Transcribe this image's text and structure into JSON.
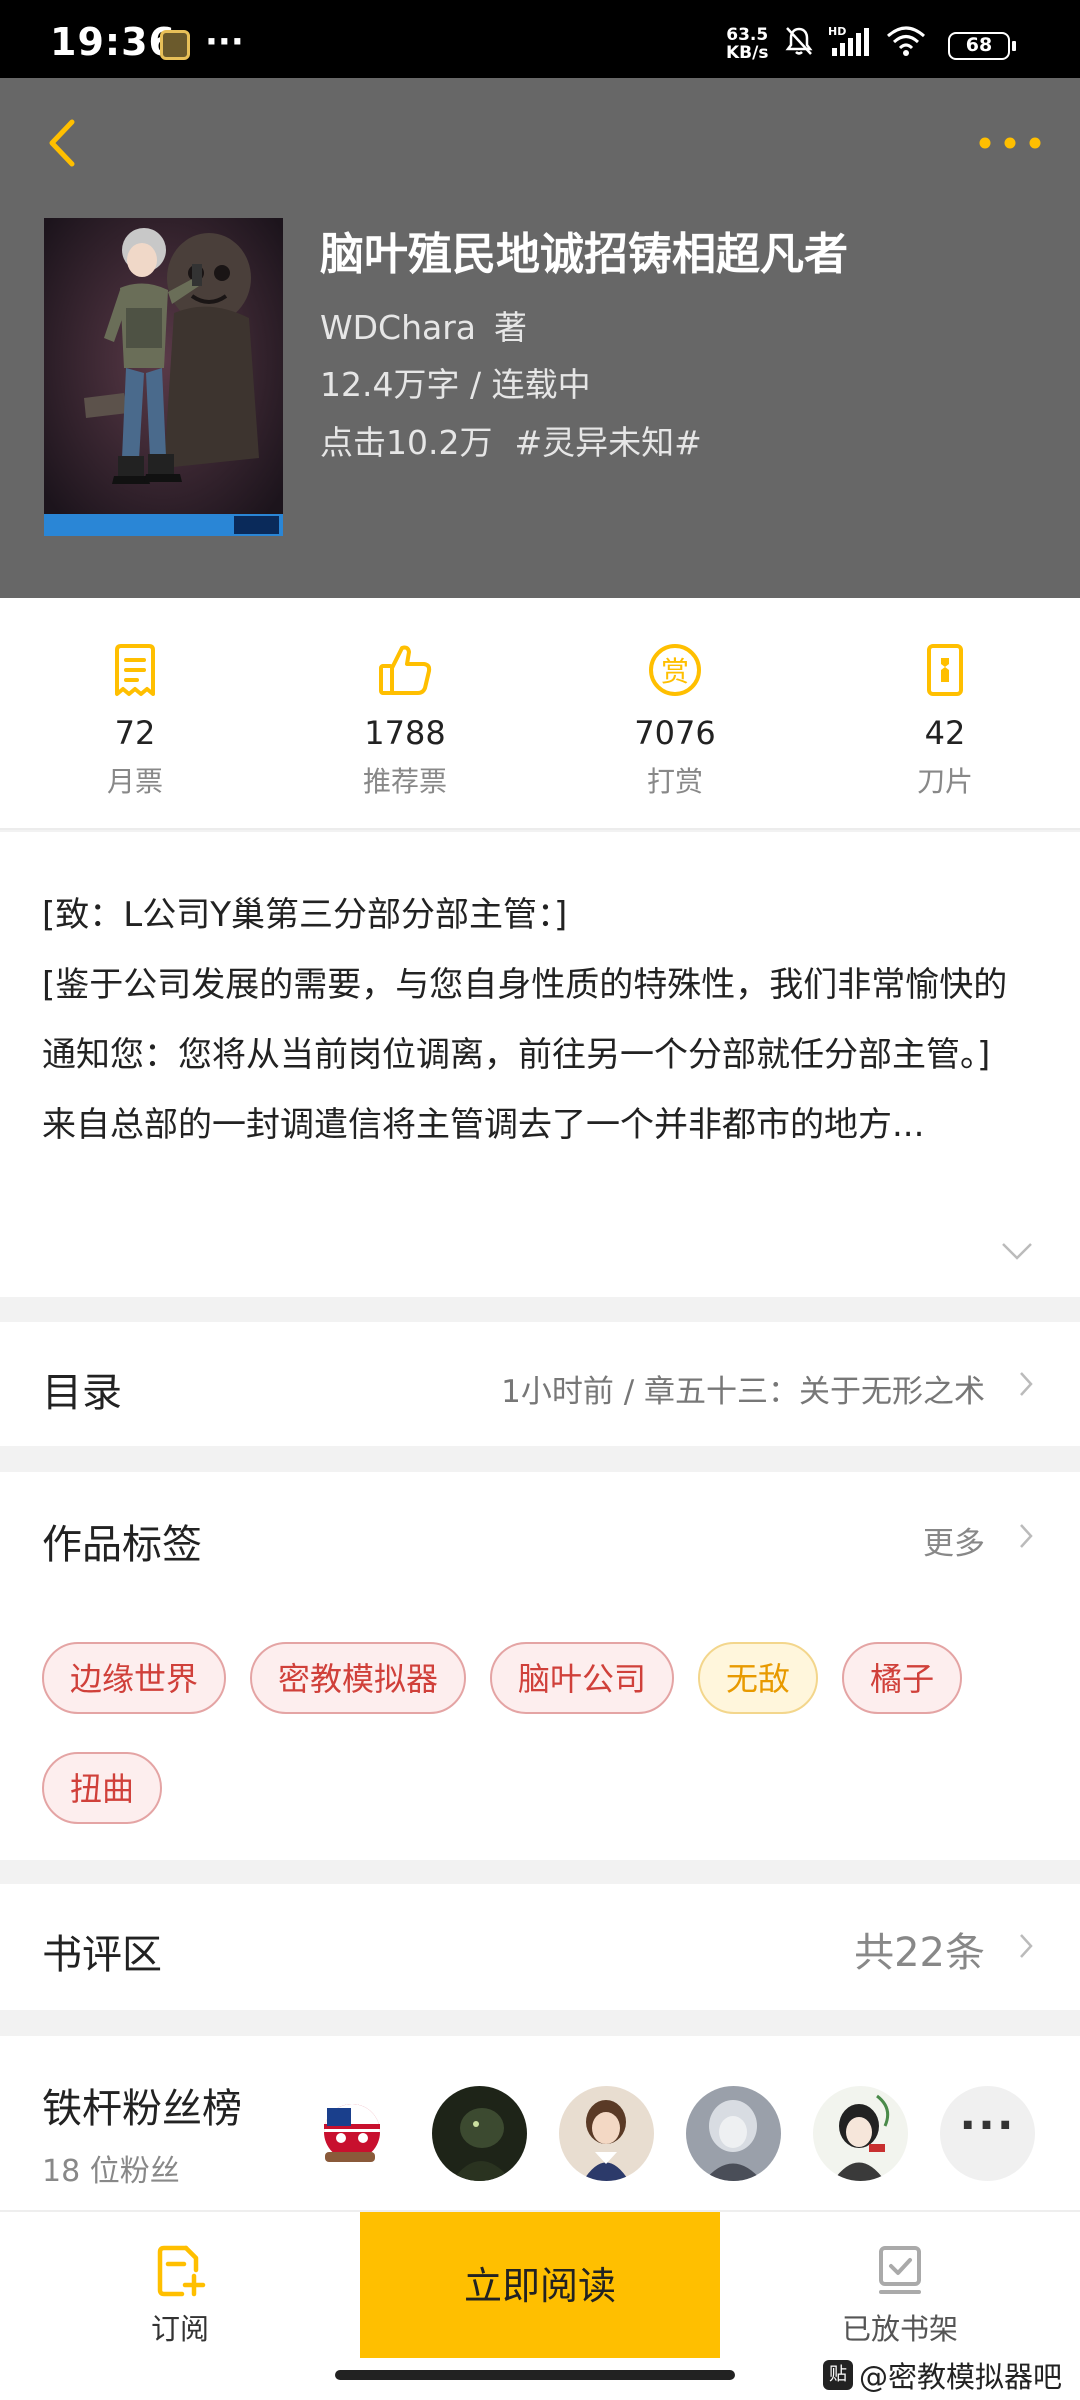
{
  "status_bar": {
    "time": "19:36",
    "dots": "···",
    "net_speed_value": "63.5",
    "net_speed_unit": "KB/s",
    "battery": "68"
  },
  "book": {
    "title": "脑叶殖民地诚招铸相超凡者",
    "author": "WDChara",
    "author_suffix": "著",
    "stats": "12.4万字 / 连载中",
    "clicks": "点击10.2万",
    "genre_tag": "#灵异未知#"
  },
  "metrics": [
    {
      "icon": "monthly-ticket-icon",
      "value": "72",
      "label": "月票"
    },
    {
      "icon": "thumbs-up-icon",
      "value": "1788",
      "label": "推荐票"
    },
    {
      "icon": "reward-coin-icon",
      "value": "7076",
      "label": "打赏"
    },
    {
      "icon": "blade-icon",
      "value": "42",
      "label": "刀片"
    }
  ],
  "description": {
    "line1": "[致：L公司Y巢第三分部分部主管：]",
    "line2": "[鉴于公司发展的需要，与您自身性质的特殊性，我们非常愉快的通知您：您将从当前岗位调离，前往另一个分部就任分部主管。]",
    "line3": "来自总部的一封调遣信将主管调去了一个并非都市的地方..."
  },
  "toc": {
    "title": "目录",
    "latest": "1小时前 / 章五十三：关于无形之术"
  },
  "tags": {
    "title": "作品标签",
    "more": "更多",
    "items": [
      {
        "label": "边缘世界",
        "style": "red"
      },
      {
        "label": "密教模拟器",
        "style": "red"
      },
      {
        "label": "脑叶公司",
        "style": "red"
      },
      {
        "label": "无敌",
        "style": "gold"
      },
      {
        "label": "橘子",
        "style": "red"
      },
      {
        "label": "扭曲",
        "style": "red"
      }
    ]
  },
  "reviews": {
    "title": "书评区",
    "count": "共22条"
  },
  "fans": {
    "title": "铁杆粉丝榜",
    "count": "18 位粉丝",
    "more": "···"
  },
  "bottom_bar": {
    "subscribe": "订阅",
    "read_now": "立即阅读",
    "on_shelf": "已放书架"
  },
  "watermark": {
    "badge": "贴",
    "text": "@密教模拟器吧"
  },
  "colors": {
    "accent": "#ffbf00",
    "header_bg": "#676767",
    "tag_red": "#d0403a",
    "tag_gold": "#e89a00"
  }
}
